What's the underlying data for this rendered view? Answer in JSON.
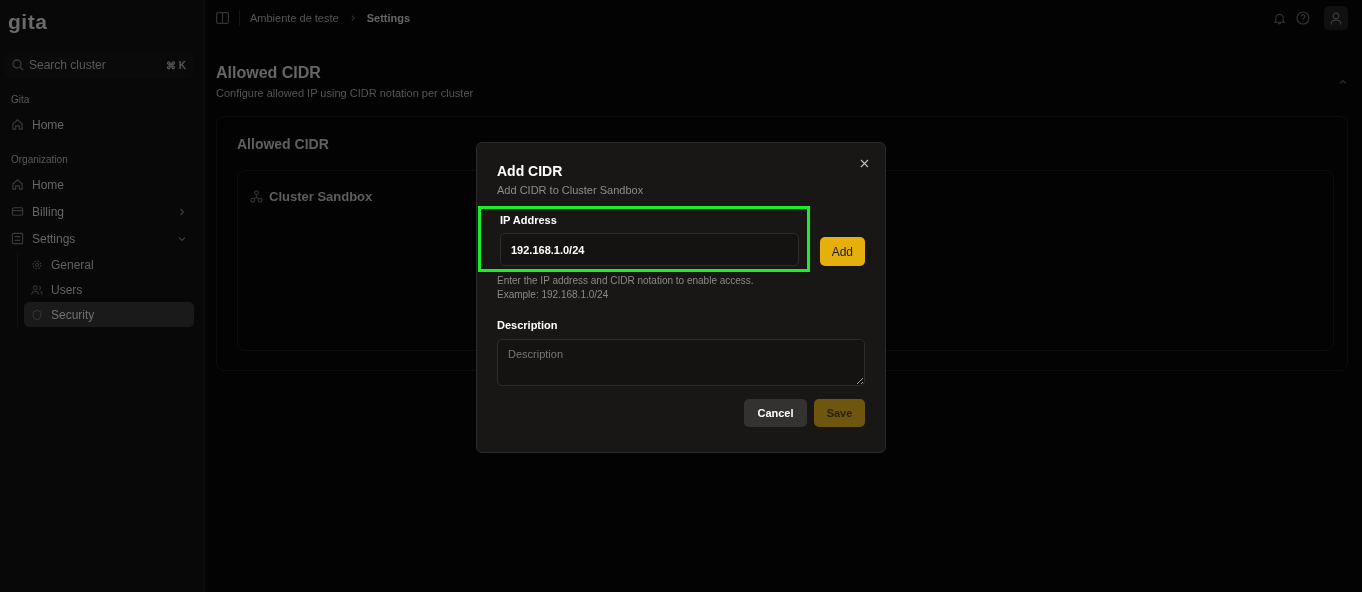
{
  "sidebar": {
    "logo": "gita",
    "search": {
      "placeholder": "Search cluster",
      "shortcut": "⌘ K"
    },
    "sections": [
      {
        "label": "Gita",
        "items": [
          {
            "label": "Home",
            "kind": "home",
            "selected": false
          }
        ]
      },
      {
        "label": "Organization",
        "items": [
          {
            "label": "Home",
            "kind": "home",
            "selected": false
          },
          {
            "label": "Billing",
            "kind": "card",
            "selected": false,
            "expandable": true,
            "expanded": false
          },
          {
            "label": "Settings",
            "kind": "settings",
            "selected": false,
            "expandable": true,
            "expanded": true,
            "children": [
              {
                "label": "General",
                "kind": "gear",
                "selected": false
              },
              {
                "label": "Users",
                "kind": "users",
                "selected": false
              },
              {
                "label": "Security",
                "kind": "shield",
                "selected": true
              }
            ]
          }
        ]
      }
    ]
  },
  "breadcrumb": [
    {
      "label": "Ambiente de teste",
      "current": false
    },
    {
      "label": "Settings",
      "current": true
    }
  ],
  "page": {
    "title": "Allowed CIDR",
    "subtitle": "Configure allowed IP using CIDR notation per cluster",
    "card_title": "Allowed CIDR",
    "cluster": "Cluster Sandbox"
  },
  "modal": {
    "title": "Add CIDR",
    "subtitle": "Add CIDR to Cluster Sandbox",
    "ip_label": "IP Address",
    "ip_value": "192.168.1.0/24",
    "highlighted": true,
    "add_button": "Add",
    "help": "Enter the IP address and CIDR notation to enable access.",
    "example": "Example: 192.168.1.0/24",
    "description_label": "Description",
    "description_placeholder": "Description",
    "cancel_button": "Cancel",
    "save_button": "Save",
    "save_disabled": true
  }
}
